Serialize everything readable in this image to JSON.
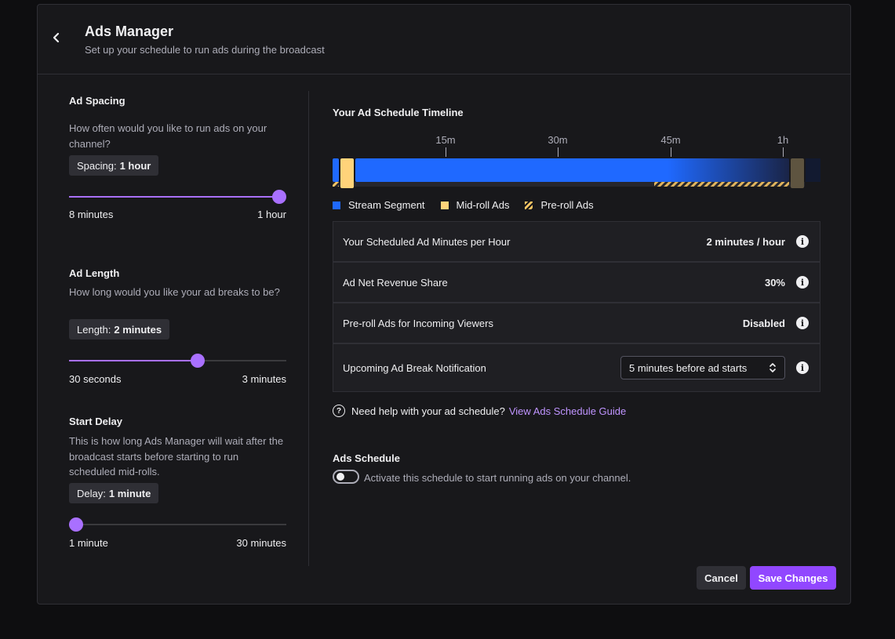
{
  "header": {
    "title": "Ads Manager",
    "subtitle": "Set up your schedule to run ads during the broadcast"
  },
  "spacing": {
    "title": "Ad Spacing",
    "description": "How often would you like to run ads on your channel?",
    "pill_label": "Spacing:",
    "pill_value": "1 hour",
    "min_label": "8 minutes",
    "max_label": "1 hour",
    "level": 1.0
  },
  "length": {
    "title": "Ad Length",
    "description": "How long would you like your ad breaks to be?",
    "pill_label": "Length:",
    "pill_value": "2 minutes",
    "min_label": "30 seconds",
    "max_label": "3 minutes",
    "level": 0.6
  },
  "delay": {
    "title": "Start Delay",
    "description": "This is how long Ads Manager will wait after the broadcast starts before starting to run scheduled mid-rolls.",
    "pill_label": "Delay:",
    "pill_value": "1 minute",
    "min_label": "1 minute",
    "max_label": "30 minutes",
    "level": 0.0
  },
  "timeline": {
    "title": "Your Ad Schedule Timeline",
    "ticks": [
      "15m",
      "30m",
      "45m",
      "1h"
    ],
    "legend": {
      "stream": "Stream Segment",
      "midroll": "Mid-roll Ads",
      "preroll": "Pre-roll Ads"
    },
    "colors": {
      "stream": "#1f69ff",
      "midroll": "#ffd37a",
      "preroll": "#f5c463"
    }
  },
  "stats": {
    "minutes_label": "Your Scheduled Ad Minutes per Hour",
    "minutes_value": "2 minutes / hour",
    "revenue_label": "Ad Net Revenue Share",
    "revenue_value": "30%",
    "preroll_label": "Pre-roll Ads for Incoming Viewers",
    "preroll_value": "Disabled",
    "notification_label": "Upcoming Ad Break Notification",
    "notification_value": "5 minutes before ad starts"
  },
  "help": {
    "text": "Need help with your ad schedule?",
    "link": "View Ads Schedule Guide"
  },
  "ads_schedule": {
    "title": "Ads Schedule",
    "description": "Activate this schedule to start running ads on your channel.",
    "active": false
  },
  "footer": {
    "cancel": "Cancel",
    "save": "Save Changes"
  }
}
